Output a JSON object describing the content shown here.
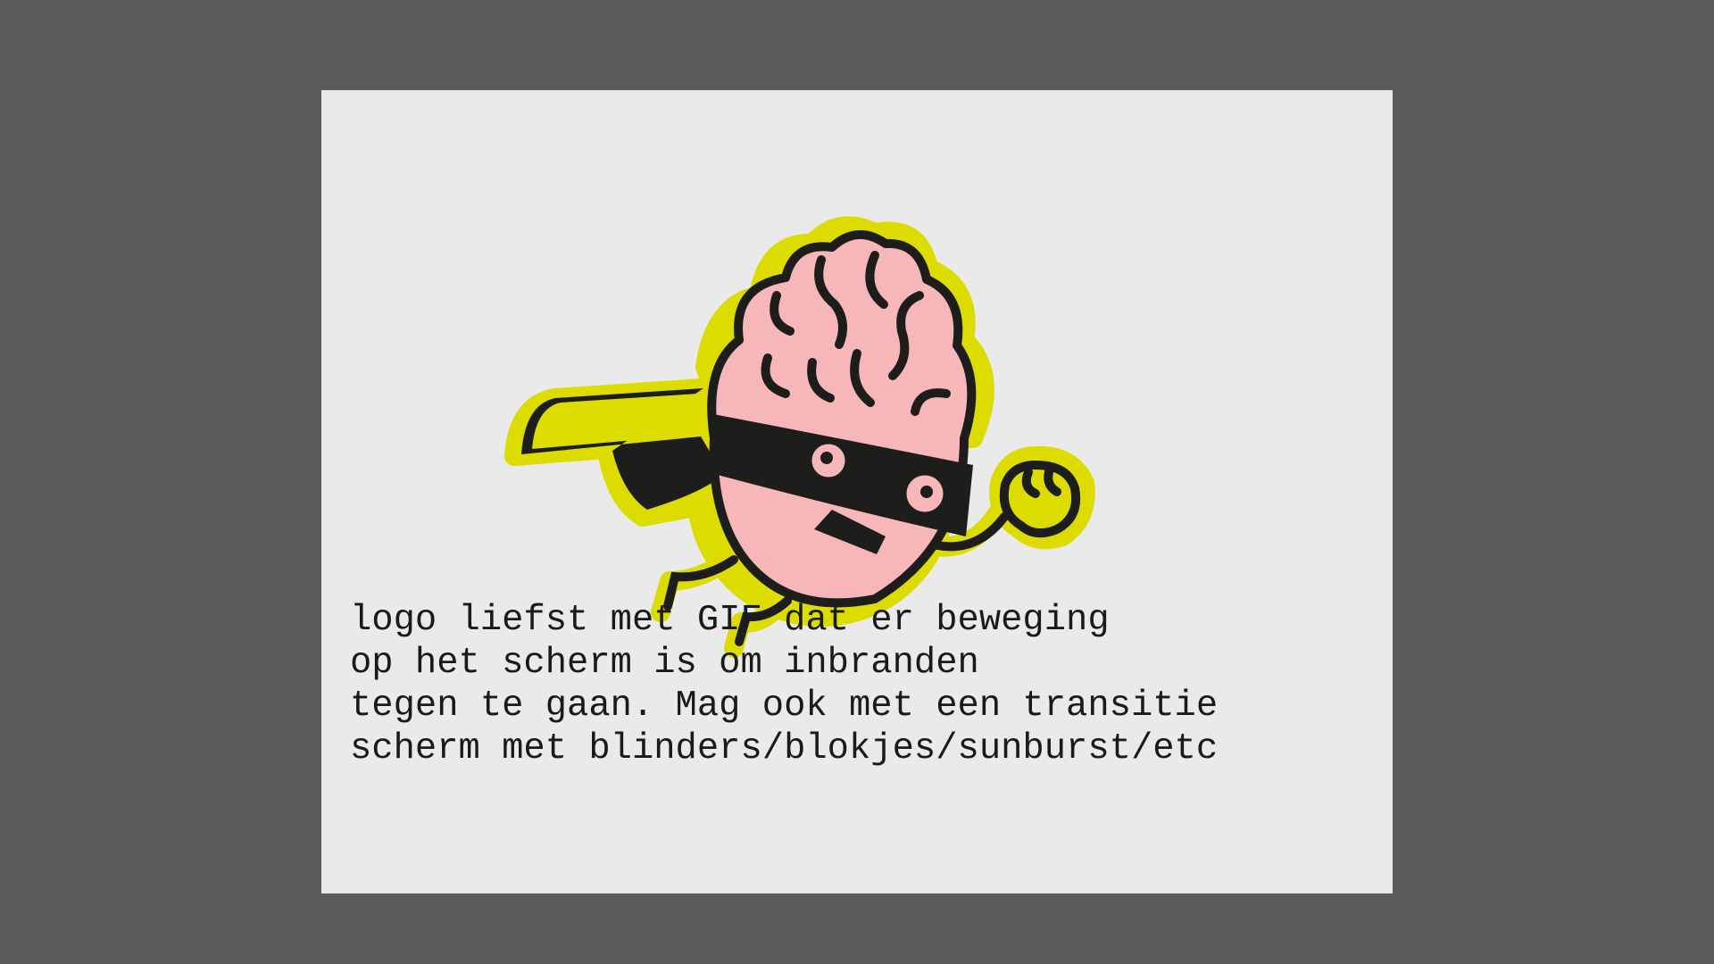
{
  "slide": {
    "logo": {
      "icon": "superhero-brain-logo-icon",
      "colors": {
        "outline": "#dcdc00",
        "brain": "#f7b7b8",
        "stroke": "#1d1d1b",
        "mask": "#1d1d1b",
        "cape": "#dcdc00",
        "background": "#eaeaea"
      }
    },
    "caption_lines": [
      "logo liefst met GIF dat er beweging",
      "op het scherm is om inbranden",
      "tegen te gaan. Mag ook met een transitie",
      "scherm met blinders/blokjes/sunburst/etc"
    ]
  }
}
